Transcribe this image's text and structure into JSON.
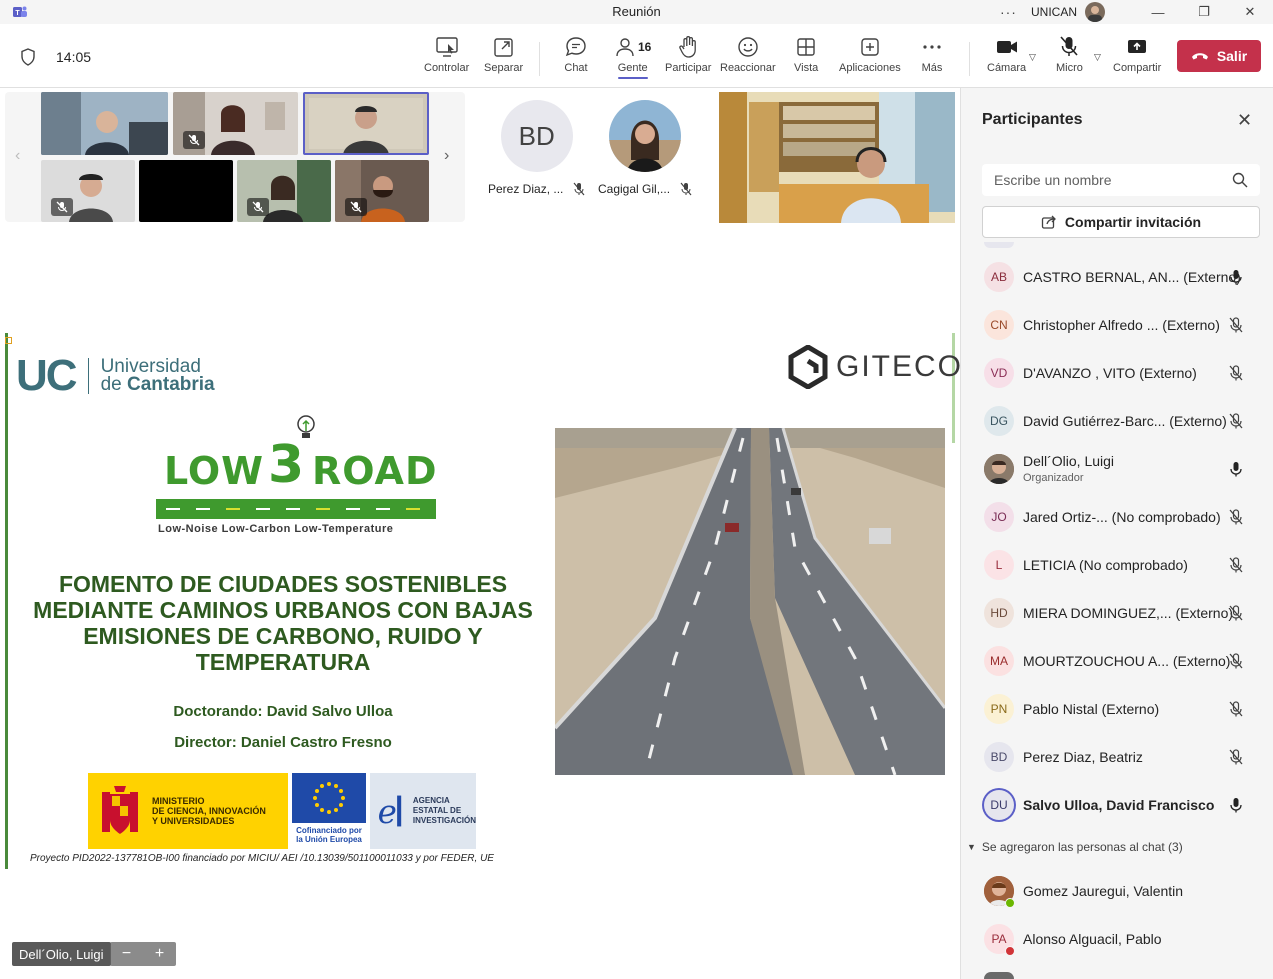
{
  "window": {
    "title": "Reunión",
    "org": "UNICAN",
    "more": "···"
  },
  "toolbar": {
    "time": "14:05",
    "buttons": {
      "control": "Controlar",
      "separate": "Separar",
      "chat": "Chat",
      "people": "Gente",
      "people_count": "16",
      "raise": "Participar",
      "react": "Reaccionar",
      "view": "Vista",
      "apps": "Aplicaciones",
      "more": "Más",
      "camera": "Cámara",
      "mic": "Micro",
      "share": "Compartir"
    },
    "leave": "Salir"
  },
  "stage": {
    "avatars": [
      {
        "initials": "BD",
        "name": "Perez Diaz, ..."
      },
      {
        "initials": "",
        "name": "Cagigal Gil,..."
      }
    ],
    "active_speaker": "Dell´Olio, Luigi"
  },
  "slide": {
    "uc_letters": "UC",
    "uc_line1": "Universidad",
    "uc_line2_pre": "de ",
    "uc_line2_bold": "Cantabria",
    "giteco": "GITECO",
    "project_logo_word1": "LOW",
    "project_logo_num": "3",
    "project_logo_word2": "ROAD",
    "project_tagline": "Low-Noise Low-Carbon Low-Temperature",
    "title_l1": "FOMENTO DE CIUDADES SOSTENIBLES",
    "title_l2": "MEDIANTE CAMINOS URBANOS CON BAJAS",
    "title_l3": "EMISIONES DE CARBONO, RUIDO Y",
    "title_l4": "TEMPERATURA",
    "student": "Doctorando: David Salvo Ulloa",
    "director": "Director: Daniel Castro Fresno",
    "funder_ministry_l1": "MINISTERIO",
    "funder_ministry_l2": "DE CIENCIA, INNOVACIÓN",
    "funder_ministry_l3": "Y UNIVERSIDADES",
    "funder_eu_l1": "Cofinanciado por",
    "funder_eu_l2": "la Unión Europea",
    "funder_aei_l1": "AGENCIA",
    "funder_aei_l2": "ESTATAL DE",
    "funder_aei_l3": "INVESTIGACIÓN",
    "footer": "Proyecto PID2022-137781OB-I00 financiado por MICIU/ AEI /10.13039/501100011033 y por FEDER, UE"
  },
  "participants": {
    "title": "Participantes",
    "search_placeholder": "Escribe un nombre",
    "share_invite": "Compartir invitación",
    "list": [
      {
        "initials": "AB",
        "name": "CASTRO BERNAL, AN... (Externo)",
        "mic": "on",
        "avatar_bg": "#f5e1e4",
        "avatar_fg": "#8a2d3c"
      },
      {
        "initials": "CN",
        "name": "Christopher Alfredo ... (Externo)",
        "mic": "off",
        "avatar_bg": "#fbe5dc",
        "avatar_fg": "#9a4a2a"
      },
      {
        "initials": "VD",
        "name": "D'AVANZO , VITO (Externo)",
        "mic": "off",
        "avatar_bg": "#f7dfe8",
        "avatar_fg": "#8a2d55"
      },
      {
        "initials": "DG",
        "name": "David Gutiérrez-Barc... (Externo)",
        "mic": "off",
        "avatar_bg": "#dfe8ec",
        "avatar_fg": "#3a5560"
      },
      {
        "initials": "",
        "name": "Dell´Olio, Luigi",
        "role": "Organizador",
        "mic": "on",
        "avatar_bg": "#7a5c48",
        "avatar_fg": "#ffffff"
      },
      {
        "initials": "JO",
        "name": "Jared Ortiz-... (No comprobado)",
        "mic": "off",
        "avatar_bg": "#f3dfe9",
        "avatar_fg": "#7a2d55"
      },
      {
        "initials": "L",
        "name": "LETICIA (No comprobado)",
        "mic": "off",
        "avatar_bg": "#fbe3e6",
        "avatar_fg": "#9a2d3c"
      },
      {
        "initials": "HD",
        "name": "MIERA DOMINGUEZ,... (Externo)",
        "mic": "off",
        "avatar_bg": "#efe3dc",
        "avatar_fg": "#6a4a3a"
      },
      {
        "initials": "MA",
        "name": "MOURTZOUCHOU A... (Externo)",
        "mic": "off",
        "avatar_bg": "#fbe1e1",
        "avatar_fg": "#9a2d2d"
      },
      {
        "initials": "PN",
        "name": "Pablo Nistal (Externo)",
        "mic": "off",
        "avatar_bg": "#fbf1d4",
        "avatar_fg": "#8a6a1a"
      },
      {
        "initials": "BD",
        "name": "Perez Diaz, Beatriz",
        "mic": "off",
        "avatar_bg": "#e6e6ee",
        "avatar_fg": "#4a4a6a"
      },
      {
        "initials": "DU",
        "name": "Salvo Ulloa, David Francisco",
        "mic": "on",
        "avatar_bg": "#e6e6ee",
        "avatar_fg": "#3a3a6a",
        "bold": true
      }
    ],
    "group_label": "Se agregaron las personas al chat (3)",
    "chat_list": [
      {
        "initials": "",
        "name": "Gomez Jauregui, Valentin",
        "status": "#6bb700",
        "avatar_bg": "#a0603c"
      },
      {
        "initials": "PA",
        "name": "Alonso Alguacil, Pablo",
        "status": "#d13438",
        "avatar_bg": "#fbe1e4",
        "avatar_fg": "#9a2d3c"
      }
    ]
  },
  "colors": {
    "accent": "#5b5fc7",
    "leave": "#c4314b",
    "slide_green": "#2e5a20",
    "logo_green": "#3f9a2e"
  }
}
